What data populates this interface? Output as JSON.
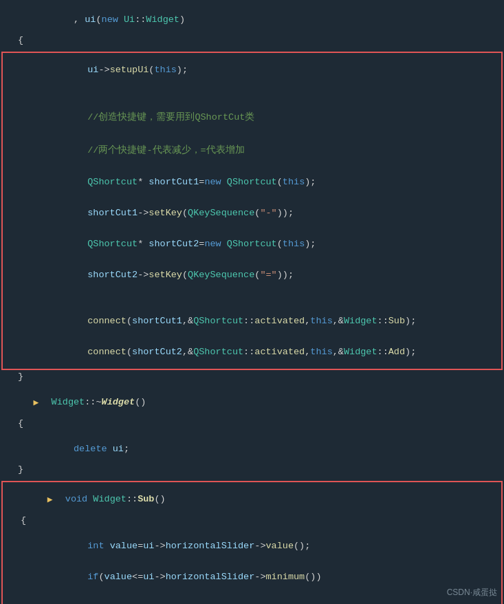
{
  "watermark": "CSDN·咸蛋挞",
  "code_lines": []
}
